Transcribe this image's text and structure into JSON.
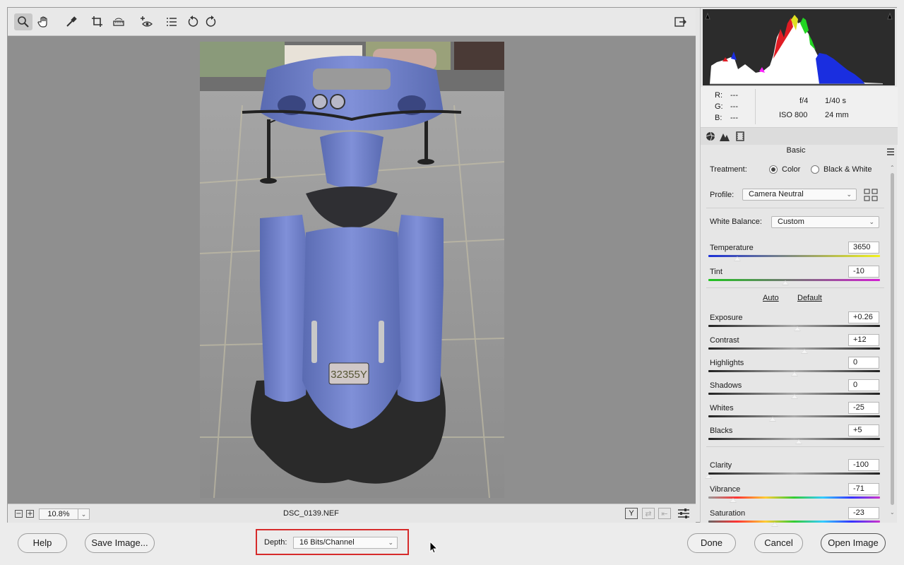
{
  "toolbar": {
    "tools": [
      "zoom-icon",
      "hand-icon",
      "white-balance-icon",
      "crop-icon",
      "straighten-icon",
      "red-eye-icon",
      "presets-icon",
      "rotate-left-icon",
      "rotate-right-icon"
    ],
    "active_tool": "zoom-icon"
  },
  "preview": {
    "zoom_value": "10.8%",
    "filename": "DSC_0139.NEF"
  },
  "readout": {
    "r_label": "R:",
    "r_value": "---",
    "g_label": "G:",
    "g_value": "---",
    "b_label": "B:",
    "b_value": "---",
    "aperture": "f/4",
    "shutter": "1/40 s",
    "iso": "ISO 800",
    "focal": "24 mm"
  },
  "panel": {
    "title": "Basic",
    "treatment_label": "Treatment:",
    "treatment_color": "Color",
    "treatment_bw": "Black & White",
    "treatment_selected": "Color",
    "profile_label": "Profile:",
    "profile_value": "Camera Neutral",
    "wb_label": "White Balance:",
    "wb_value": "Custom",
    "auto_label": "Auto",
    "default_label": "Default",
    "sliders": [
      {
        "label": "Temperature",
        "value": "3650",
        "pos": 0.17,
        "track": "temp"
      },
      {
        "label": "Tint",
        "value": "-10",
        "pos": 0.45,
        "track": "tint"
      },
      {
        "label": "Exposure",
        "value": "+0.26",
        "pos": 0.52,
        "track": "gray"
      },
      {
        "label": "Contrast",
        "value": "+12",
        "pos": 0.56,
        "track": "gray"
      },
      {
        "label": "Highlights",
        "value": "0",
        "pos": 0.5,
        "track": "gray"
      },
      {
        "label": "Shadows",
        "value": "0",
        "pos": 0.5,
        "track": "gray"
      },
      {
        "label": "Whites",
        "value": "-25",
        "pos": 0.375,
        "track": "gray"
      },
      {
        "label": "Blacks",
        "value": "+5",
        "pos": 0.525,
        "track": "gray"
      },
      {
        "label": "Clarity",
        "value": "-100",
        "pos": 0.0,
        "track": "gray"
      },
      {
        "label": "Vibrance",
        "value": "-71",
        "pos": 0.145,
        "track": "vib"
      },
      {
        "label": "Saturation",
        "value": "-23",
        "pos": 0.385,
        "track": "sat"
      }
    ]
  },
  "footer": {
    "help": "Help",
    "save": "Save Image...",
    "depth_label": "Depth:",
    "depth_value": "16 Bits/Channel",
    "done": "Done",
    "cancel": "Cancel",
    "open": "Open Image"
  },
  "colors": {
    "highlight_border": "#d62b2b",
    "preview_bg": "#8f8f8f",
    "bike_blue": "#6f80c8"
  }
}
